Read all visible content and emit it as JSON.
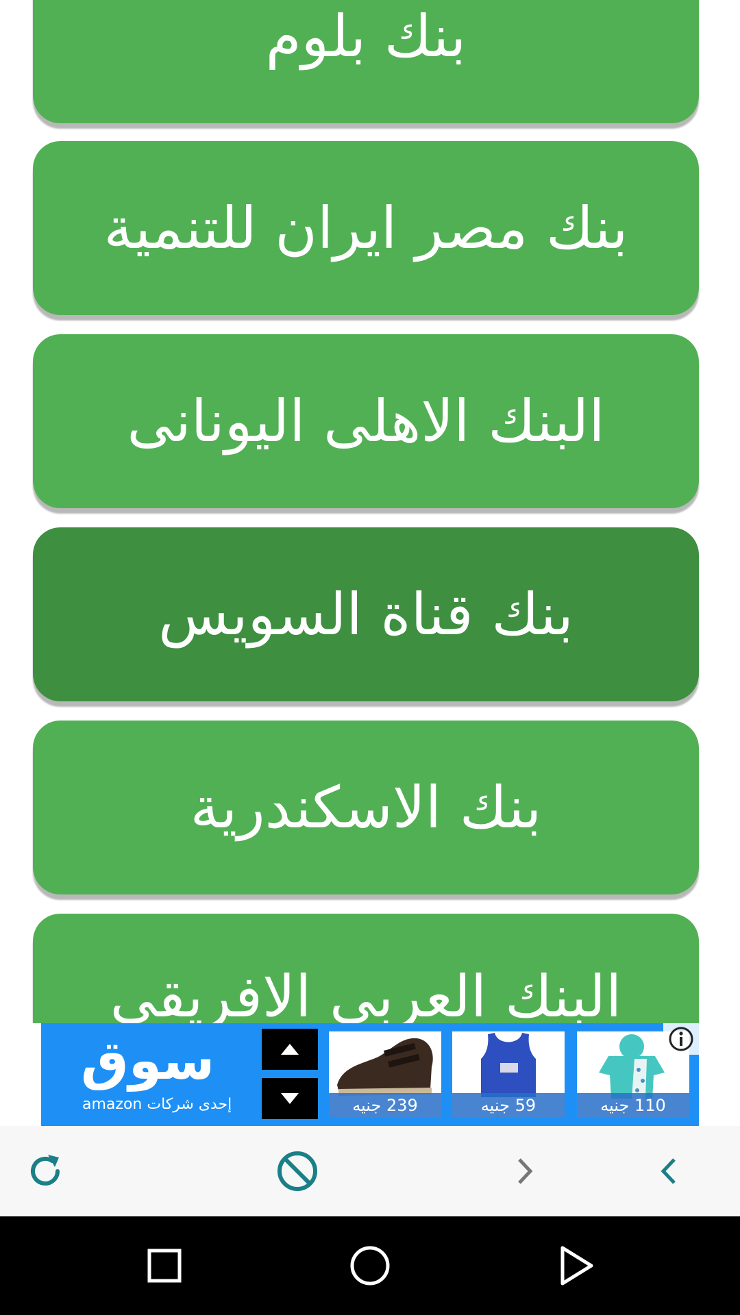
{
  "banks": [
    {
      "label": "بنك بلوم"
    },
    {
      "label": "بنك مصر ايران للتنمية"
    },
    {
      "label": "البنك الاهلى اليونانى"
    },
    {
      "label": "بنك قناة السويس"
    },
    {
      "label": "بنك الاسكندرية"
    },
    {
      "label": "البنك العربي الافريقي"
    }
  ],
  "ad": {
    "brand": "سوق",
    "tagline": "إحدى شركات amazon",
    "products": [
      {
        "price": "239 جنيه",
        "icon": "shoe"
      },
      {
        "price": "59 جنيه",
        "icon": "tank-top"
      },
      {
        "price": "110 جنيه",
        "icon": "baby-romper"
      }
    ],
    "info_icon": "info-icon"
  },
  "toolbar": {
    "icons": [
      "refresh-icon",
      "block-icon",
      "forward-icon",
      "back-icon"
    ],
    "accent": "#1a7f86"
  },
  "navbar": {
    "icons": [
      "recents-square-icon",
      "home-circle-icon",
      "back-triangle-icon"
    ]
  },
  "colors": {
    "button": "#52b054",
    "button_pressed": "#3e8f40",
    "ad_background": "#1e90f5"
  }
}
